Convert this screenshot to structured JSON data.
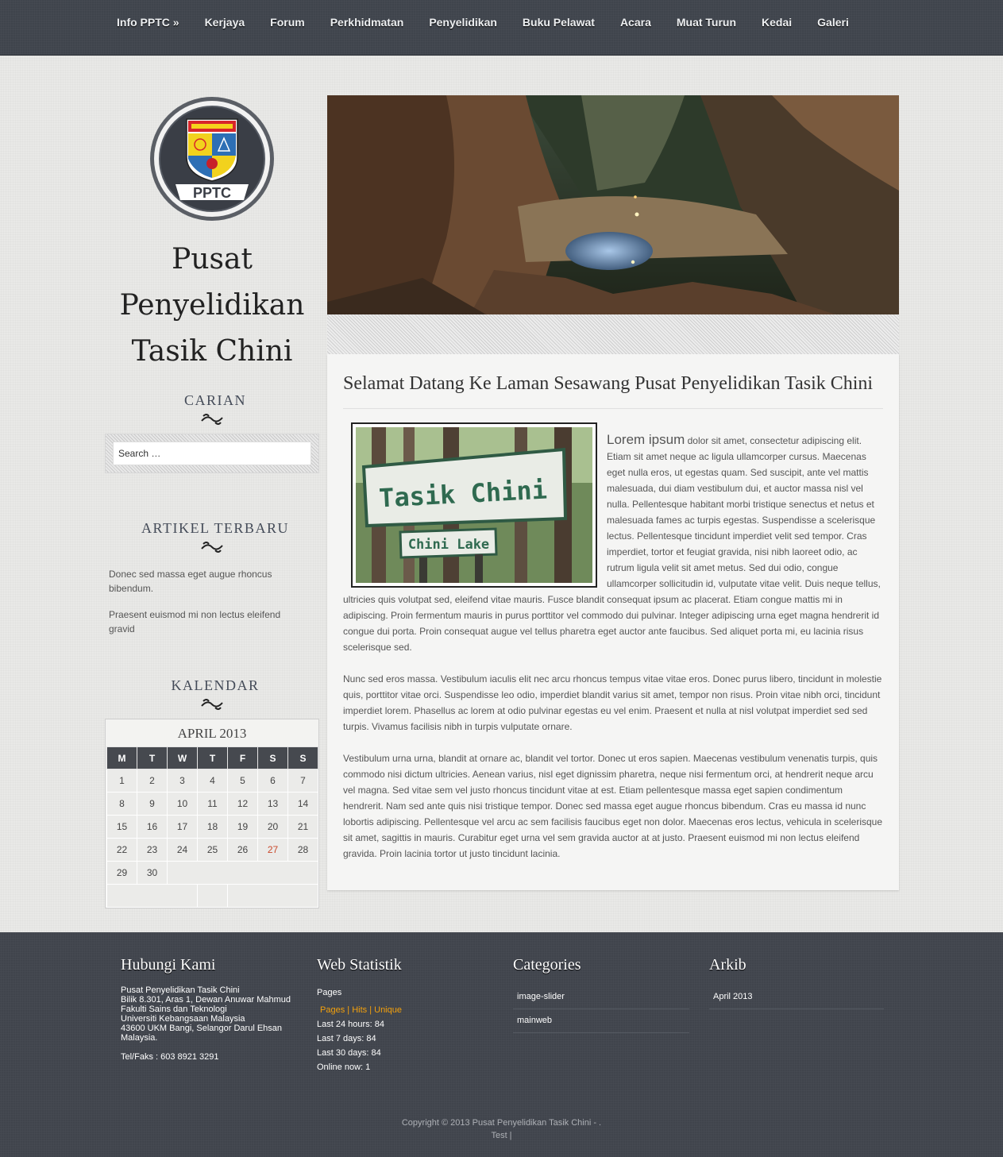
{
  "nav": {
    "items": [
      "Info PPTC »",
      "Kerjaya",
      "Forum",
      "Perkhidmatan",
      "Penyelidikan",
      "Buku Pelawat",
      "Acara",
      "Muat Turun",
      "Kedai",
      "Galeri"
    ]
  },
  "logo": {
    "text": "PPTC"
  },
  "site": {
    "title_line1": "Pusat",
    "title_line2": "Penyelidikan",
    "title_line3": "Tasik Chini"
  },
  "sidebar": {
    "search_title": "CARIAN",
    "search_placeholder": "Search …",
    "recent_title": "ARTIKEL TERBARU",
    "recent_posts": [
      "Donec sed massa eget augue rhoncus bibendum.",
      "Praesent euismod mi non lectus eleifend gravid"
    ],
    "calendar_title": "KALENDAR",
    "calendar": {
      "caption": "APRIL 2013",
      "weekdays": [
        "M",
        "T",
        "W",
        "T",
        "F",
        "S",
        "S"
      ],
      "weeks": [
        [
          "1",
          "2",
          "3",
          "4",
          "5",
          "6",
          "7"
        ],
        [
          "8",
          "9",
          "10",
          "11",
          "12",
          "13",
          "14"
        ],
        [
          "15",
          "16",
          "17",
          "18",
          "19",
          "20",
          "21"
        ],
        [
          "22",
          "23",
          "24",
          "25",
          "26",
          "27",
          "28"
        ],
        [
          "29",
          "30"
        ]
      ],
      "today": "27"
    }
  },
  "post": {
    "title": "Selamat Datang Ke Laman Sesawang Pusat Penyelidikan Tasik Chini",
    "photo_sign_main": "Tasik Chini",
    "photo_sign_sub": "Chini Lake",
    "lead": "Lorem ipsum",
    "p1": " dolor sit amet, consectetur adipiscing elit. Etiam sit amet neque ac ligula ullamcorper cursus. Maecenas eget nulla eros, ut egestas quam. Sed suscipit, ante vel mattis malesuada, dui diam vestibulum dui, et auctor massa nisl vel nulla. Pellentesque habitant morbi tristique senectus et netus et malesuada fames ac turpis egestas. Suspendisse a scelerisque lectus. Pellentesque tincidunt imperdiet velit sed tempor. Cras imperdiet, tortor et feugiat gravida, nisi nibh laoreet odio, ac rutrum ligula velit sit amet metus. Sed dui odio, congue ullamcorper sollicitudin id, vulputate vitae velit. Duis neque tellus, ultricies quis volutpat sed, eleifend vitae mauris. Fusce blandit consequat ipsum ac placerat. Etiam congue mattis mi in adipiscing. Proin fermentum mauris in purus porttitor vel commodo dui pulvinar. Integer adipiscing urna eget magna hendrerit id congue dui porta. Proin consequat augue vel tellus pharetra eget auctor ante faucibus. Sed aliquet porta mi, eu lacinia risus scelerisque sed.",
    "p2": "Nunc sed eros massa. Vestibulum iaculis elit nec arcu rhoncus tempus vitae vitae eros. Donec purus libero, tincidunt in molestie quis, porttitor vitae orci. Suspendisse leo odio, imperdiet blandit varius sit amet, tempor non risus. Proin vitae nibh orci, tincidunt imperdiet lorem. Phasellus ac lorem at odio pulvinar egestas eu vel enim. Praesent et nulla at nisl volutpat imperdiet sed sed turpis. Vivamus facilisis nibh in turpis vulputate ornare.",
    "p3": "Vestibulum urna urna, blandit at ornare ac, blandit vel tortor. Donec ut eros sapien. Maecenas vestibulum venenatis turpis, quis commodo nisi dictum ultricies. Aenean varius, nisl eget dignissim pharetra, neque nisi fermentum orci, at hendrerit neque arcu vel magna. Sed vitae sem vel justo rhoncus tincidunt vitae at est. Etiam pellentesque massa eget sapien condimentum hendrerit. Nam sed ante quis nisi tristique tempor. Donec sed massa eget augue rhoncus bibendum. Cras eu massa id nunc lobortis adipiscing. Pellentesque vel arcu ac sem facilisis faucibus eget non dolor. Maecenas eros lectus, vehicula in scelerisque sit amet, sagittis in mauris. Curabitur eget urna vel sem gravida auctor at at justo. Praesent euismod mi non lectus eleifend gravida. Proin lacinia tortor ut justo tincidunt lacinia."
  },
  "footer": {
    "contact": {
      "title": "Hubungi Kami",
      "lines": [
        "Pusat Penyelidikan Tasik Chini",
        "Bilik 8.301, Aras 1, Dewan Anuwar Mahmud",
        "Fakulti Sains dan Teknologi",
        "Universiti Kebangsaan Malaysia",
        "43600 UKM Bangi, Selangor Darul Ehsan",
        "Malaysia."
      ],
      "phone": "Tel/Faks : 603 8921 3291"
    },
    "stats": {
      "title": "Web Statistik",
      "label": "Pages",
      "tab_pages": "Pages",
      "tab_hits": "Hits",
      "tab_unique": "Unique",
      "separator": "|",
      "last24": "Last 24 hours: 84",
      "last7": "Last 7 days: 84",
      "last30": "Last 30 days: 84",
      "online": "Online now: 1"
    },
    "categories": {
      "title": "Categories",
      "items": [
        "image-slider",
        "mainweb"
      ]
    },
    "archive": {
      "title": "Arkib",
      "items": [
        "April 2013"
      ]
    },
    "copyright_line1": "Copyright © 2013 Pusat Penyelidikan Tasik Chini - .",
    "copyright_line2": "Test |"
  },
  "colors": {
    "nav_bg": "#3f444c",
    "footer_bg": "#40444c",
    "accent_orange": "#f4a10c",
    "today_red": "#c9492c",
    "calendar_header": "#46494f"
  }
}
